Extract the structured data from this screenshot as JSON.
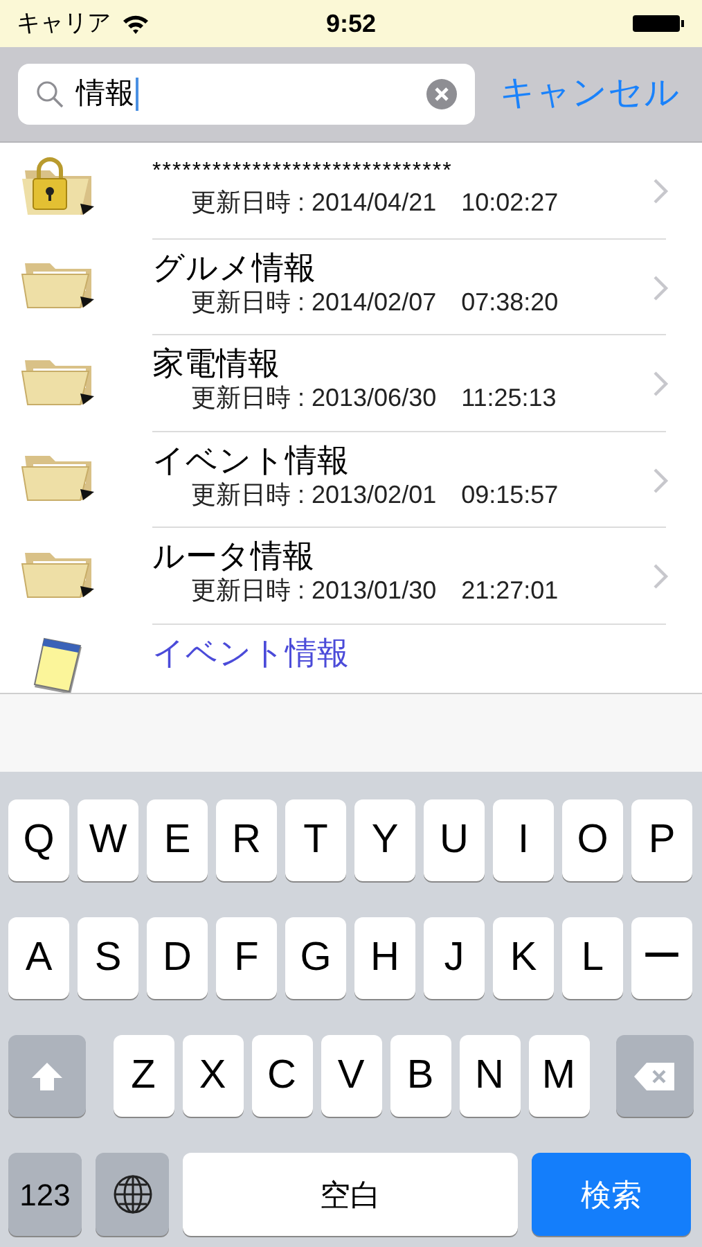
{
  "status_bar": {
    "carrier": "キャリア",
    "time": "9:52"
  },
  "search": {
    "value": "情報",
    "cancel": "キャンセル"
  },
  "items": [
    {
      "kind": "locked-folder",
      "title": "******************************",
      "updated": "更新日時 : 2014/04/21　10:02:27"
    },
    {
      "kind": "folder",
      "title": "グルメ情報",
      "updated": "更新日時 : 2014/02/07　07:38:20"
    },
    {
      "kind": "folder",
      "title": "家電情報",
      "updated": "更新日時 : 2013/06/30　11:25:13"
    },
    {
      "kind": "folder",
      "title": "イベント情報",
      "updated": "更新日時 : 2013/02/01　09:15:57"
    },
    {
      "kind": "folder",
      "title": "ルータ情報",
      "updated": "更新日時 : 2013/01/30　21:27:01"
    },
    {
      "kind": "note",
      "title": "イベント情報"
    }
  ],
  "keyboard": {
    "rows": [
      [
        "Q",
        "W",
        "E",
        "R",
        "T",
        "Y",
        "U",
        "I",
        "O",
        "P"
      ],
      [
        "A",
        "S",
        "D",
        "F",
        "G",
        "H",
        "J",
        "K",
        "L",
        "ー"
      ],
      [
        "Z",
        "X",
        "C",
        "V",
        "B",
        "N",
        "M"
      ]
    ],
    "numbers_key": "123",
    "space_key": "空白",
    "search_key": "検索"
  }
}
